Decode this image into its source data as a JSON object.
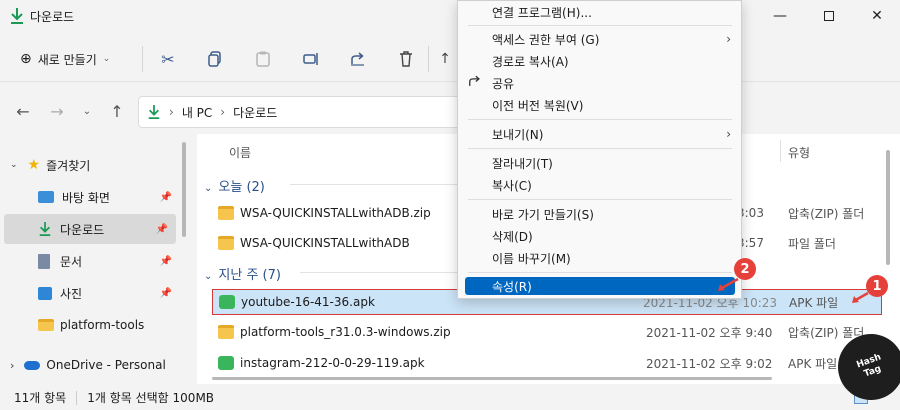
{
  "window": {
    "title": "다운로드"
  },
  "toolbar": {
    "new_label": "새로 만들기"
  },
  "address": {
    "pc": "내 PC",
    "folder": "다운로드"
  },
  "sidebar": {
    "items": [
      {
        "label": "즐겨찾기"
      },
      {
        "label": "바탕 화면"
      },
      {
        "label": "다운로드"
      },
      {
        "label": "문서"
      },
      {
        "label": "사진"
      },
      {
        "label": "platform-tools"
      },
      {
        "label": "OneDrive - Personal"
      }
    ]
  },
  "columns": {
    "name": "이름",
    "type": "유형"
  },
  "groups": [
    {
      "label": "오늘 (2)"
    },
    {
      "label": "지난 주 (7)"
    }
  ],
  "files": [
    {
      "name": "WSA-QUICKINSTALLwithADB.zip",
      "date": "3:03",
      "type": "압축(ZIP) 폴더"
    },
    {
      "name": "WSA-QUICKINSTALLwithADB",
      "date": "3:57",
      "type": "파일 폴더"
    },
    {
      "name": "youtube-16-41-36.apk",
      "date": "2021-11-02 오후 10:23",
      "type": "APK 파일"
    },
    {
      "name": "platform-tools_r31.0.3-windows.zip",
      "date": "2021-11-02 오후 9:40",
      "type": "압축(ZIP) 폴더"
    },
    {
      "name": "instagram-212-0-0-29-119.apk",
      "date": "2021-11-02 오후 9:02",
      "type": "APK 파일"
    }
  ],
  "status": {
    "count": "11개 항목",
    "selected": "1개 항목 선택함 100MB"
  },
  "context_menu": {
    "items": [
      {
        "label": "연결 프로그램(H)..."
      },
      {
        "label": "액세스 권한 부여 (G)"
      },
      {
        "label": "경로로 복사(A)"
      },
      {
        "label": "공유"
      },
      {
        "label": "이전 버전 복원(V)"
      },
      {
        "label": "보내기(N)"
      },
      {
        "label": "잘라내기(T)"
      },
      {
        "label": "복사(C)"
      },
      {
        "label": "바로 가기 만들기(S)"
      },
      {
        "label": "삭제(D)"
      },
      {
        "label": "이름 바꾸기(M)"
      },
      {
        "label": "속성(R)"
      }
    ]
  },
  "badges": {
    "one": "1",
    "two": "2"
  },
  "logo": {
    "line1": "Hash",
    "line2": "Tag"
  },
  "colors": {
    "accent": "#0067c0",
    "selected_row": "#cce4f7",
    "highlight_border": "#d33a3a",
    "badge": "#e5403a"
  }
}
